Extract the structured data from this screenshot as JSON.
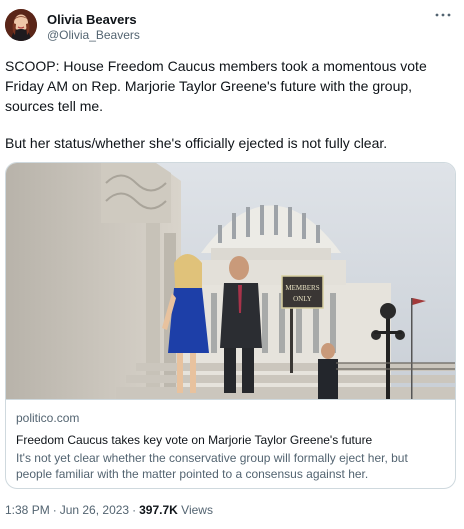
{
  "author": {
    "name": "Olivia Beavers",
    "handle": "@Olivia_Beavers"
  },
  "more_icon": "more-horizontal-icon",
  "tweet": {
    "paragraph_1": "SCOOP: House Freedom Caucus members took a momentous vote Friday AM on Rep. Marjorie Taylor Greene's future with the group, sources tell me.",
    "paragraph_2": "But her status/whether she's officially ejected is not fully clear."
  },
  "card": {
    "sign_text": "MEMBERS ONLY",
    "domain": "politico.com",
    "title": "Freedom Caucus takes key vote on Marjorie Taylor Greene's future",
    "description": "It's not yet clear whether the conservative group will formally eject her, but people familiar with the matter pointed to a consensus against her."
  },
  "footer": {
    "time": "1:38 PM",
    "separator": "·",
    "date": "Jun 26, 2023",
    "views_count": "397.7K",
    "views_label": "Views"
  }
}
